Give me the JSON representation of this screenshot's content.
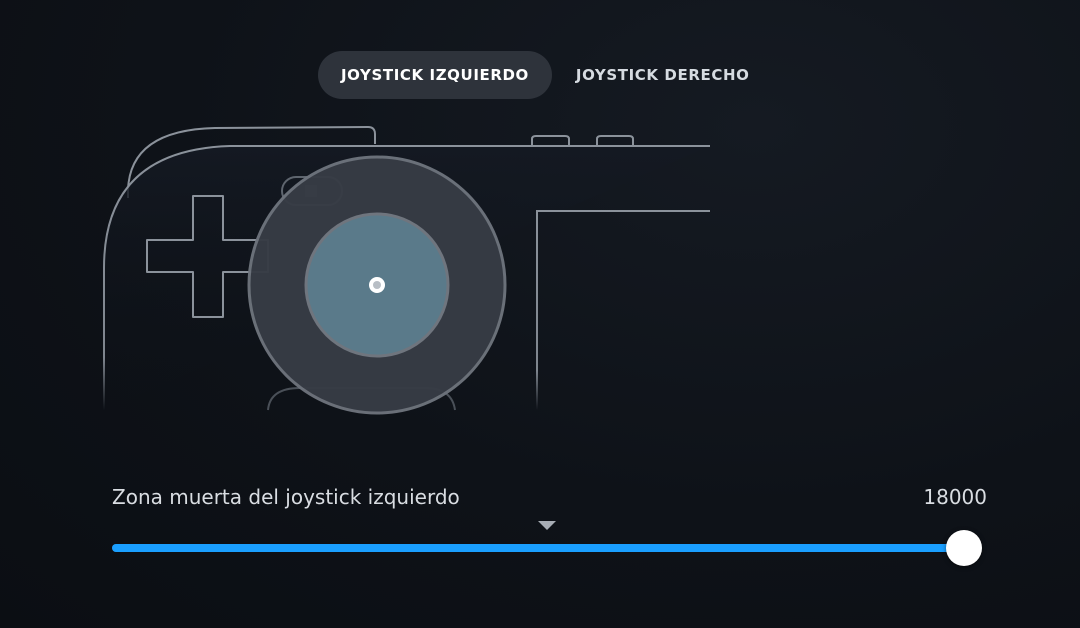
{
  "tabs": [
    {
      "label": "JOYSTICK IZQUIERDO",
      "active": true
    },
    {
      "label": "JOYSTICK DERECHO",
      "active": false
    }
  ],
  "slider": {
    "label": "Zona muerta del joystick izquierdo",
    "value": "18000",
    "fill_fraction": 1.0,
    "default_marker_fraction": 0.5
  },
  "colors": {
    "accent": "#1a9fff",
    "stick_inner": "#5a7a8a",
    "tab_active_bg": "#2e333b"
  }
}
